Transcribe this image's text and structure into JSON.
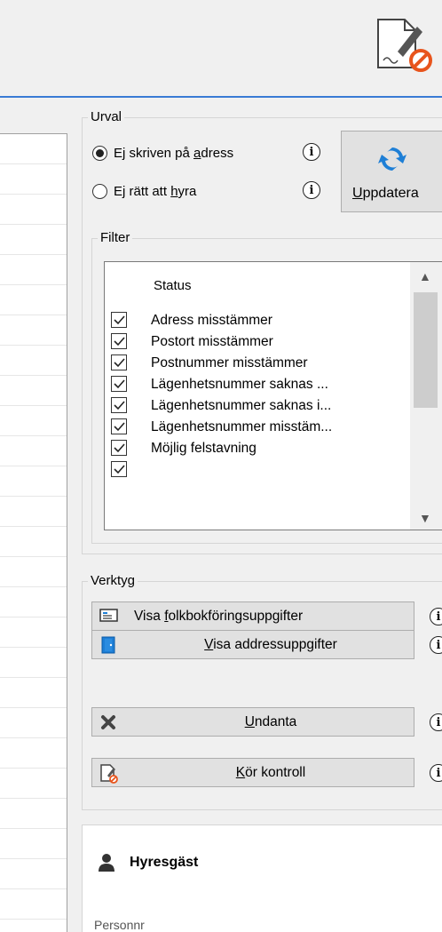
{
  "toolbar": {
    "icon": "document-blocked-icon"
  },
  "urval": {
    "title": "Urval",
    "options": [
      {
        "pre": "Ej skriven på ",
        "accel": "a",
        "post": "dress",
        "selected": true
      },
      {
        "pre": "Ej rätt att ",
        "accel": "h",
        "post": "yra",
        "selected": false
      }
    ],
    "update_button": {
      "accel": "U",
      "rest": "ppdatera",
      "icon": "sync-icon"
    }
  },
  "filter": {
    "title": "Filter",
    "header": "Status",
    "items": [
      {
        "label": "Adress misstämmer",
        "checked": true
      },
      {
        "label": "Postort misstämmer",
        "checked": true
      },
      {
        "label": "Postnummer misstämmer",
        "checked": true
      },
      {
        "label": "Lägenhetsnummer saknas ...",
        "checked": true
      },
      {
        "label": "Lägenhetsnummer saknas i...",
        "checked": true
      },
      {
        "label": "Lägenhetsnummer misstäm...",
        "checked": true
      },
      {
        "label": "Möjlig felstavning",
        "checked": true
      }
    ]
  },
  "verktyg": {
    "title": "Verktyg",
    "buttons": [
      {
        "pre": "Visa ",
        "accel": "f",
        "post": "olkbokföringsuppgifter",
        "icon": "id-card-icon"
      },
      {
        "pre": "",
        "accel": "V",
        "post": "isa addressuppgifter",
        "icon": "door-icon"
      },
      {
        "pre": "",
        "accel": "U",
        "post": "ndanta",
        "icon": "close-icon"
      },
      {
        "pre": "",
        "accel": "K",
        "post": "ör kontroll",
        "icon": "document-check-icon"
      }
    ]
  },
  "tenant": {
    "title": "Hyresgäst",
    "field_label": "Personnr"
  },
  "colors": {
    "accent": "#3a7bd5",
    "sync_blue": "#1e7fd6",
    "blocked_orange": "#e8541c"
  }
}
